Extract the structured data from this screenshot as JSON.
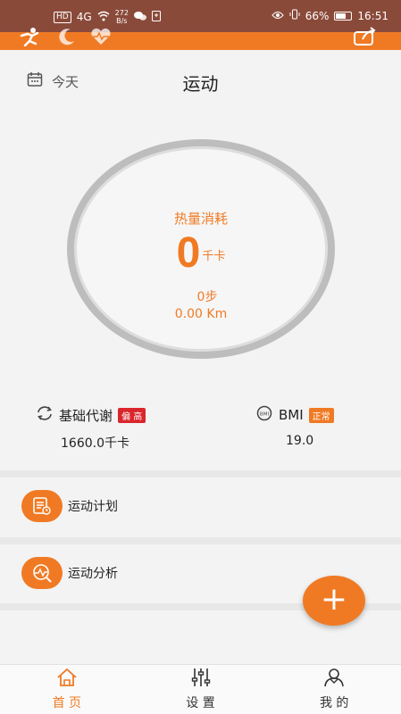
{
  "status_bar": {
    "left": [
      "HD",
      "4G"
    ],
    "net_speed_value": "272",
    "net_speed_unit": "B/s",
    "battery": "66%",
    "time": "16:51"
  },
  "header": {
    "date_label": "今天",
    "title": "运动"
  },
  "calorie_ring": {
    "label": "热量消耗",
    "value": "0",
    "unit": "千卡",
    "steps": "0步",
    "distance": "0.00 Km"
  },
  "stats": {
    "bmr": {
      "label": "基础代谢",
      "badge": "偏 高",
      "value": "1660.0千卡",
      "badge_color": "#d9262c"
    },
    "bmi": {
      "label": "BMI",
      "badge": "正常",
      "value": "19.0",
      "badge_color": "#f07a24"
    }
  },
  "menu": {
    "plan": "运动计划",
    "analysis": "运动分析"
  },
  "fab": {
    "label": "+"
  },
  "bottom_nav": {
    "home": "首 页",
    "settings": "设 置",
    "mine": "我 的"
  },
  "colors": {
    "accent": "#f07a24",
    "statusbar": "#8a4a3a"
  }
}
